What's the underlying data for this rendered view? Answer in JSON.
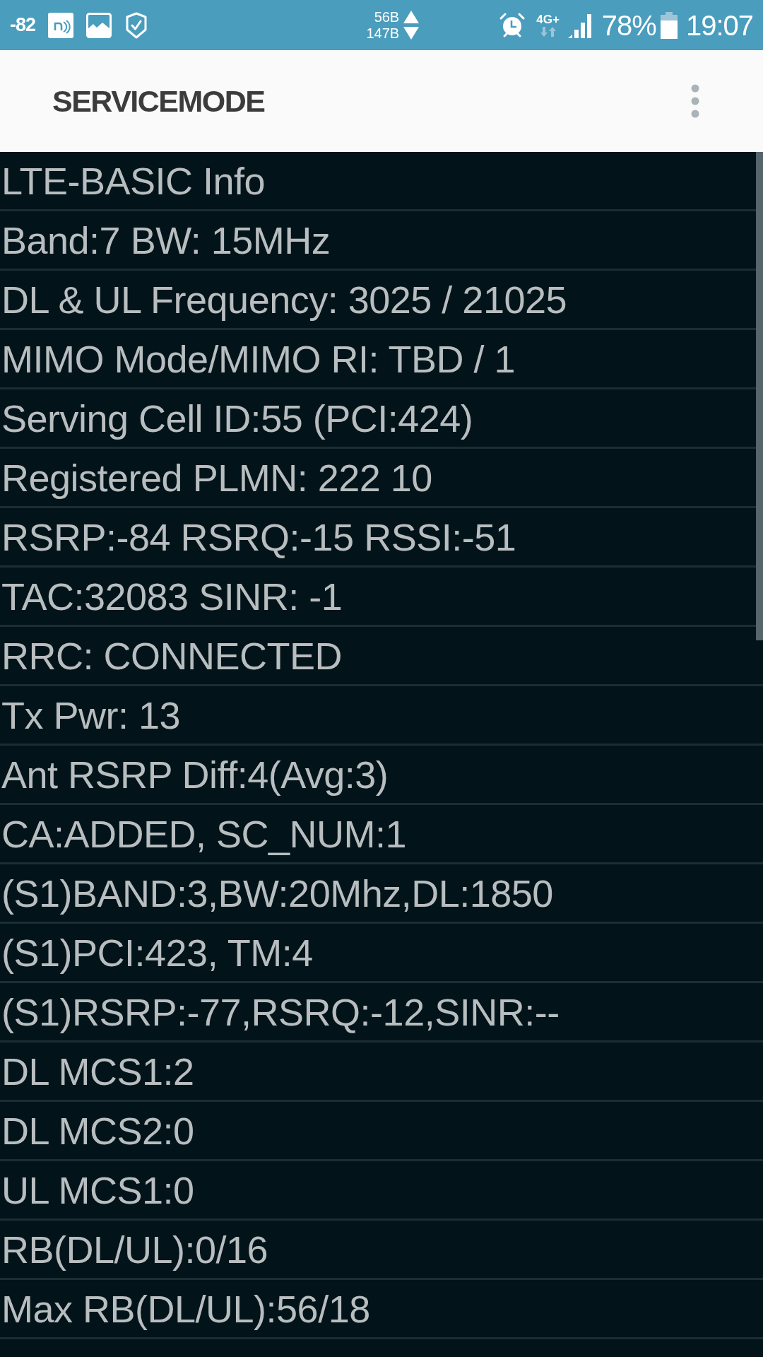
{
  "status_bar": {
    "signal_reading": "-82",
    "upload_speed": "56B",
    "download_speed": "147B",
    "network_type": "4G+",
    "battery_percent": "78%",
    "time": "19:07"
  },
  "app_bar": {
    "title": "SERVICEMODE"
  },
  "info_rows": [
    "LTE-BASIC Info",
    "Band:7 BW: 15MHz",
    "DL & UL Frequency: 3025 / 21025",
    "MIMO Mode/MIMO RI: TBD / 1",
    "Serving Cell ID:55 (PCI:424)",
    "Registered PLMN: 222 10",
    "RSRP:-84 RSRQ:-15 RSSI:-51",
    "TAC:32083 SINR: -1",
    "RRC: CONNECTED",
    "Tx Pwr: 13",
    "Ant RSRP Diff:4(Avg:3)",
    "CA:ADDED, SC_NUM:1",
    "(S1)BAND:3,BW:20Mhz,DL:1850",
    "(S1)PCI:423, TM:4",
    "(S1)RSRP:-77,RSRQ:-12,SINR:--",
    "DL MCS1:2",
    "DL MCS2:0",
    "UL MCS1:0",
    "RB(DL/UL):0/16",
    "Max RB(DL/UL):56/18"
  ]
}
